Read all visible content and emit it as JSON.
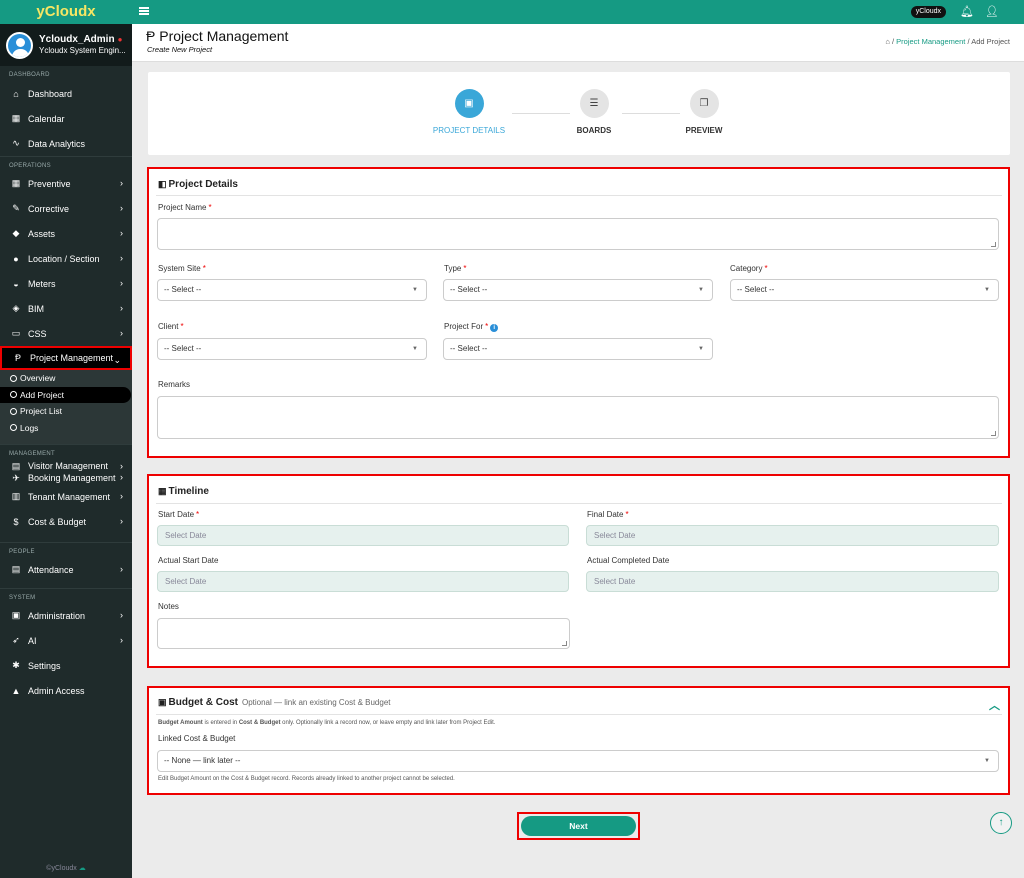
{
  "app": {
    "brand": "yCloudx",
    "footer": "©yCloudx"
  },
  "user": {
    "name": "Ycloudx_Admin",
    "role": "Ycloudx System Engin..."
  },
  "topbar": {
    "badge": "yCloudx"
  },
  "sidebar": {
    "sections": [
      {
        "title": "DASHBOARD",
        "items": [
          {
            "label": "Dashboard",
            "icon": "home-icon",
            "glyph": "⌂"
          },
          {
            "label": "Calendar",
            "icon": "calendar-icon",
            "glyph": "▦"
          },
          {
            "label": "Data Analytics",
            "icon": "chart-line-icon",
            "glyph": "∿"
          }
        ]
      },
      {
        "title": "OPERATIONS",
        "items": [
          {
            "label": "Preventive",
            "icon": "calendar-check-icon",
            "glyph": "▦"
          },
          {
            "label": "Corrective",
            "icon": "wrench-icon",
            "glyph": "✎"
          },
          {
            "label": "Assets",
            "icon": "tag-icon",
            "glyph": "◆"
          },
          {
            "label": "Location / Section",
            "icon": "globe-icon",
            "glyph": "●"
          },
          {
            "label": "Meters",
            "icon": "gauge-icon",
            "glyph": "◒"
          },
          {
            "label": "BIM",
            "icon": "cube-icon",
            "glyph": "◈"
          },
          {
            "label": "CSS",
            "icon": "monitor-icon",
            "glyph": "▭"
          },
          {
            "label": "Project Management",
            "icon": "project-icon",
            "glyph": "Ᵽ"
          }
        ]
      },
      {
        "title": "MANAGEMENT",
        "items": [
          {
            "label": "Visitor Management",
            "icon": "id-card-icon",
            "glyph": "▤"
          },
          {
            "label": "Booking Management",
            "icon": "plane-icon",
            "glyph": "✈"
          },
          {
            "label": "Tenant Management",
            "icon": "building-icon",
            "glyph": "▥"
          },
          {
            "label": "Cost & Budget",
            "icon": "dollar-icon",
            "glyph": "$"
          }
        ]
      },
      {
        "title": "PEOPLE",
        "items": [
          {
            "label": "Attendance",
            "icon": "clipboard-icon",
            "glyph": "▤"
          }
        ]
      },
      {
        "title": "SYSTEM",
        "items": [
          {
            "label": "Administration",
            "icon": "user-shield-icon",
            "glyph": "▣"
          },
          {
            "label": "AI",
            "icon": "rocket-icon",
            "glyph": "➶"
          },
          {
            "label": "Settings",
            "icon": "gear-icon",
            "glyph": "✱"
          },
          {
            "label": "Admin Access",
            "icon": "lock-icon",
            "glyph": "▲"
          }
        ]
      }
    ],
    "project_sub": [
      "Overview",
      "Add Project",
      "Project List",
      "Logs"
    ]
  },
  "header": {
    "title": "Project Management",
    "subtitle": "Create New Project",
    "breadcrumb": {
      "link": "Project Management",
      "sep": "/",
      "current": "Add Project"
    }
  },
  "steps": [
    "PROJECT DETAILS",
    "BOARDS",
    "PREVIEW"
  ],
  "details": {
    "title": "Project Details",
    "project_name": "Project Name",
    "system_site": "System Site",
    "type": "Type",
    "category": "Category",
    "client": "Client",
    "project_for": "Project For",
    "remarks": "Remarks",
    "select_placeholder": "-- Select --"
  },
  "timeline": {
    "title": "Timeline",
    "start_date": "Start Date",
    "final_date": "Final Date",
    "actual_start": "Actual Start Date",
    "actual_completed": "Actual Completed Date",
    "notes": "Notes",
    "date_placeholder": "Select Date"
  },
  "budget": {
    "title": "Budget & Cost",
    "optional": "Optional — link an existing Cost & Budget",
    "note1_a": "Budget Amount",
    "note1_b": " is entered in ",
    "note1_c": "Cost & Budget",
    "note1_d": " only. Optionally link a record now, or leave empty and link later from Project Edit.",
    "linked_label": "Linked Cost & Budget",
    "linked_value": "-- None — link later --",
    "note2": "Edit Budget Amount on the Cost & Budget record. Records already linked to another project cannot be selected."
  },
  "next_label": "Next"
}
